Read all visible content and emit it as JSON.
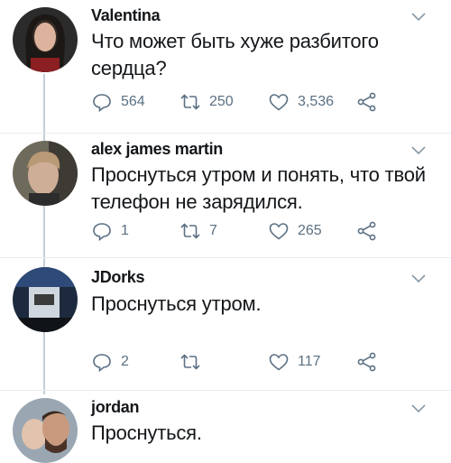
{
  "tweets": [
    {
      "name": "Valentina",
      "text_lines": [
        "Что может быть хуже разбитого",
        "сердца?"
      ],
      "replies": "564",
      "retweets": "250",
      "likes": "3,536"
    },
    {
      "name": "alex james martin",
      "text_lines": [
        "Проснуться утром и понять, что твой",
        "телефон не зарядился."
      ],
      "replies": "1",
      "retweets": "7",
      "likes": "265"
    },
    {
      "name": "JDorks",
      "text_lines": [
        "Проснуться утром."
      ],
      "replies": "2",
      "retweets": "",
      "likes": "117"
    },
    {
      "name": "jordan",
      "text_lines": [
        "Проснуться."
      ]
    }
  ],
  "icons": {
    "reply": "reply-icon",
    "retweet": "retweet-icon",
    "like": "heart-icon",
    "share": "share-icon",
    "more": "chevron-down-icon"
  },
  "colors": {
    "text": "#14171a",
    "meta": "#5b7083",
    "line": "#c4cfd6"
  }
}
